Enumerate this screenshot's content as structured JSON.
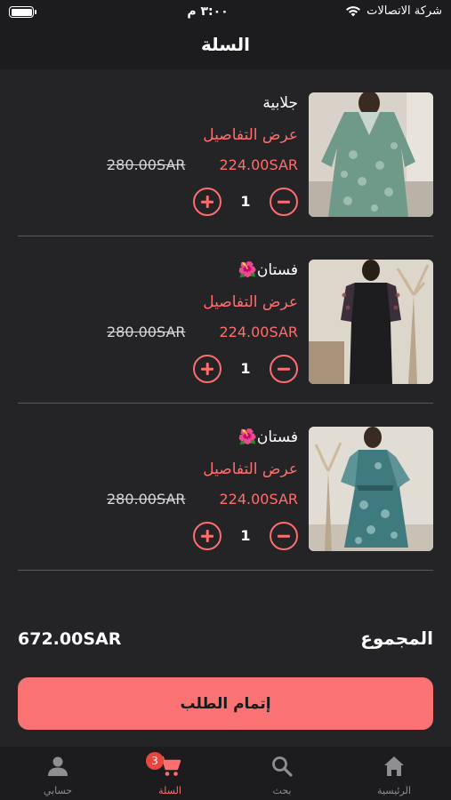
{
  "status_bar": {
    "time": "٣:٠٠ م",
    "carrier": "شركة الاتصالات",
    "battery": "full"
  },
  "header": {
    "title": "السلة"
  },
  "cart": {
    "items": [
      {
        "name": "جلابية",
        "details_label": "عرض التفاصيل",
        "price": "224.00SAR",
        "old_price": "280.00SAR",
        "quantity": "1",
        "image": "green-floral-kaftan"
      },
      {
        "name": "فستان🌺",
        "details_label": "عرض التفاصيل",
        "price": "224.00SAR",
        "old_price": "280.00SAR",
        "quantity": "1",
        "image": "black-embroidered-dress"
      },
      {
        "name": "فستان🌺",
        "details_label": "عرض التفاصيل",
        "price": "224.00SAR",
        "old_price": "280.00SAR",
        "quantity": "1",
        "image": "teal-printed-wrap-dress"
      }
    ]
  },
  "summary": {
    "total_label": "المجموع",
    "total_value": "672.00SAR"
  },
  "checkout": {
    "label": "إتمام الطلب"
  },
  "tabbar": {
    "tabs": [
      {
        "label": "حسابي",
        "icon": "person-icon"
      },
      {
        "label": "السلة",
        "icon": "cart-icon",
        "badge": "3",
        "active": true
      },
      {
        "label": "بحث",
        "icon": "search-icon"
      },
      {
        "label": "الرئيسية",
        "icon": "home-icon"
      }
    ]
  },
  "colors": {
    "accent": "#fa7271",
    "background": "#242426",
    "bar_background": "#1c1c1e",
    "badge": "#e5463d"
  }
}
